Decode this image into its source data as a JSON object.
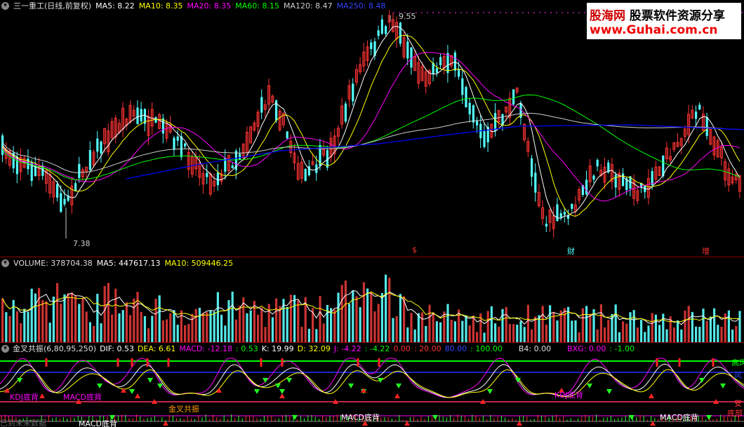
{
  "main_pane": {
    "dropdown_icon": "chevron-down-icon",
    "stock_title": "三一重工(日线,前复权)",
    "ma5": "MA5: 8.22",
    "ma10": "MA10: 8.35",
    "ma20": "MA20: 8.35",
    "ma60": "MA60: 8.15",
    "ma120": "MA120: 8.47",
    "ma250": "MA250: 8.48",
    "high_label": "9.55",
    "low_label": "7.38",
    "event_markers": [
      "$",
      "财",
      "增"
    ],
    "colors": {
      "ma5": "#ffffff",
      "ma10": "#ffff00",
      "ma20": "#ff00ff",
      "ma60": "#00ff00",
      "ma120": "#cccccc",
      "ma250": "#0000ff",
      "up": "#ff3333",
      "down": "#54ffff"
    }
  },
  "watermark": {
    "brand": "股海网",
    "slogan": "股票软件资源分享",
    "url": "www.Guhai.com.cn"
  },
  "volume_pane": {
    "label": "VOLUME: 378704.38",
    "ma5": "MA5: 447617.13",
    "ma10": "MA10: 509446.25"
  },
  "indicator_pane": {
    "name": "金叉共振(6,80,95,250)",
    "dif": "DIF: 0.53",
    "dea": "DEA: 6.61",
    "macd": "MACD: -12.18",
    "v1": ": 0.53",
    "k": "K: 19.99",
    "d": "D: 32.09",
    "j": "J: -4.22",
    "v2": ": -4.22",
    "v3": "0.00",
    "v4": ": 20.00",
    "v5": "80.00",
    "v6": ": 100.00",
    "b4": "B4: 0.00",
    "bxg": "BXG: 0.00",
    "v7": ": -1.00",
    "right_labels": [
      "高风",
      "风",
      "安",
      "底部"
    ],
    "annotations": [
      "KDJ底背",
      "MACD底背",
      "金叉共振",
      "KDJ底背",
      "MACD底背",
      "MACD底背",
      "MACD底背"
    ],
    "bottom_left": "已到未来数据"
  }
}
